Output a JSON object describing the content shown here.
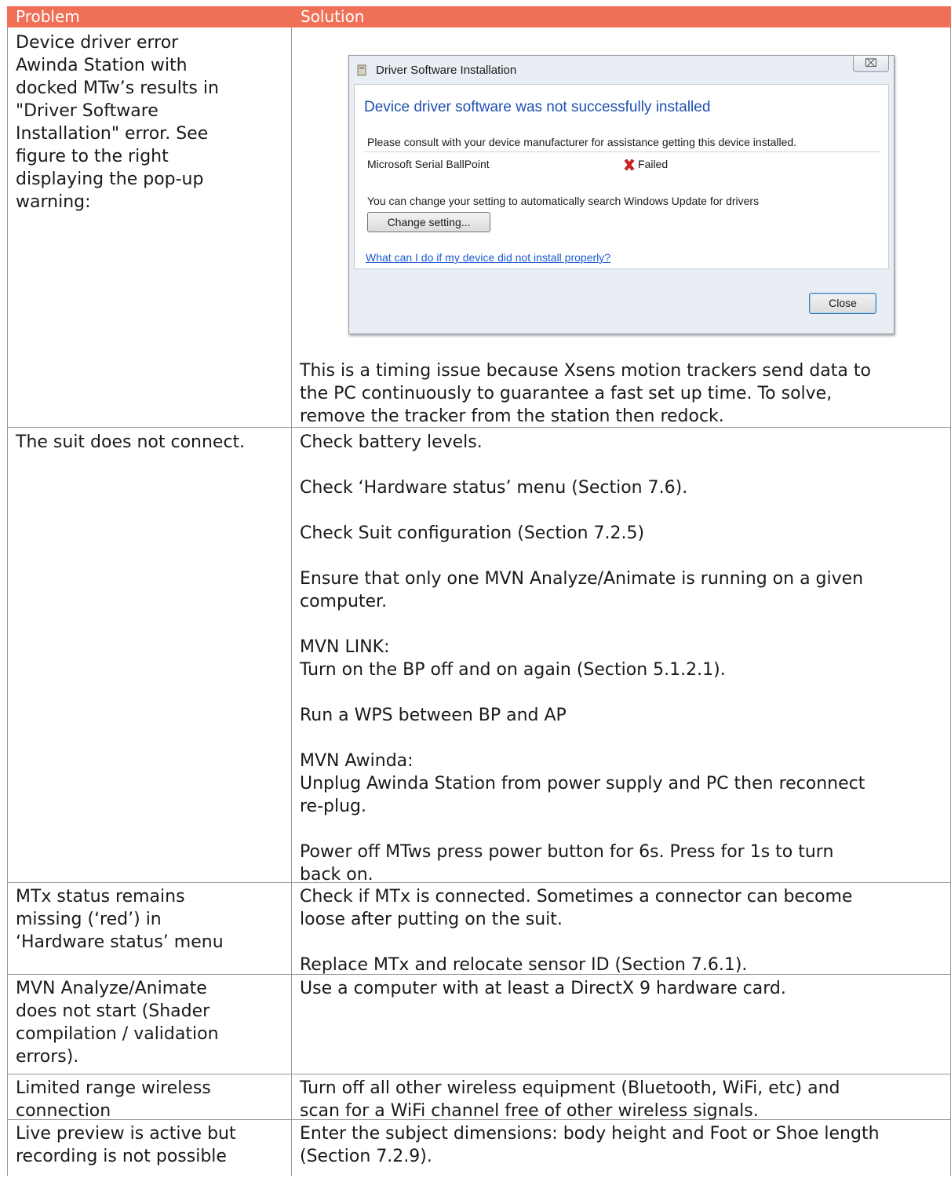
{
  "table": {
    "header": {
      "problem": "Problem",
      "solution": "Solution"
    },
    "rows": [
      {
        "problem": [
          "Device driver error",
          "Awinda Station with",
          "docked MTw’s results in",
          "\"Driver Software",
          "Installation\" error. See",
          "figure to the right",
          "displaying the pop-up",
          "warning:"
        ],
        "solution": [
          "This is a timing issue because Xsens motion trackers send data to",
          "the PC continuously to guarantee a fast set up time. To solve,",
          "remove the tracker from the station then redock."
        ]
      },
      {
        "problem": [
          "The suit does not connect."
        ],
        "solution": [
          [
            "Check battery levels."
          ],
          [
            "Check ‘Hardware status’ menu (Section 7.6)."
          ],
          [
            "Check Suit configuration (Section 7.2.5)"
          ],
          [
            "Ensure that only one MVN Analyze/Animate is running on a given",
            "computer."
          ],
          [
            "MVN LINK:",
            "Turn on the BP off and on again (Section 5.1.2.1)."
          ],
          [
            "Run a WPS between BP and AP"
          ],
          [
            "MVN Awinda:",
            "Unplug Awinda Station from power supply and PC then reconnect",
            "re-plug."
          ],
          [
            "Power off MTws press power button for 6s. Press for 1s to turn",
            "back on."
          ]
        ]
      },
      {
        "problem": [
          "MTx status remains",
          "missing (‘red’) in",
          "‘Hardware status’ menu"
        ],
        "solution": [
          [
            "Check if MTx is connected. Sometimes a connector can become",
            "loose after putting on the suit."
          ],
          [
            "Replace MTx and relocate sensor ID (Section 7.6.1)."
          ]
        ]
      },
      {
        "problem": [
          "MVN Analyze/Animate",
          "does not start (Shader",
          "compilation / validation",
          "errors)."
        ],
        "solution": [
          "Use a computer with at least a DirectX 9 hardware card."
        ]
      },
      {
        "problem": [
          "Limited range wireless",
          "connection"
        ],
        "solution": [
          "Turn off all other wireless equipment (Bluetooth, WiFi, etc) and",
          "scan for a WiFi channel free of other wireless signals."
        ]
      },
      {
        "problem": [
          "Live preview is active but",
          "recording is not possible"
        ],
        "solution": [
          "Enter the subject dimensions: body height and Foot or Shoe length",
          "(Section 7.2.9)."
        ]
      }
    ]
  },
  "dialog": {
    "title": "Driver Software Installation",
    "close_glyph": "⌧",
    "heading": "Device driver software was not successfully installed",
    "consult": "Please consult with your device manufacturer for assistance getting this device installed.",
    "device_name": "Microsoft Serial BallPoint",
    "status": "Failed",
    "update_note": "You can change your setting to automatically search Windows Update for drivers",
    "change_button": "Change setting...",
    "help_link": "What can I do if my device did not install properly?",
    "close_button": "Close",
    "status_color": "#d42020"
  },
  "colors": {
    "header": "#f07057",
    "heading": "#1e4fb0",
    "link": "#1c5bd1"
  }
}
